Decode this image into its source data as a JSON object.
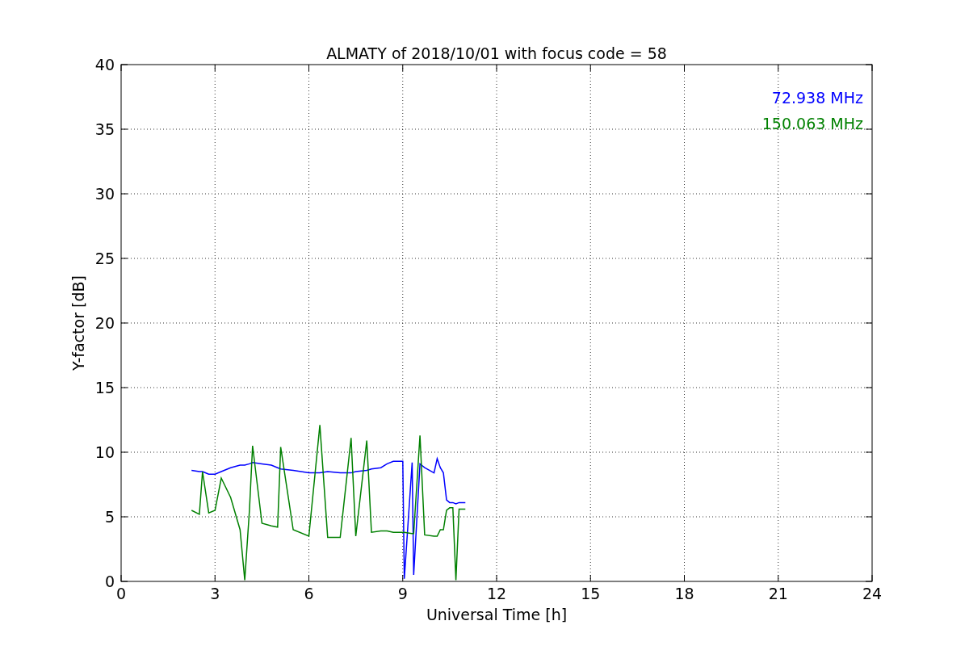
{
  "figure": {
    "chart_data": {
      "type": "line",
      "title": "ALMATY of 2018/10/01 with focus code = 58",
      "xlabel": "Universal Time [h]",
      "ylabel": "Y-factor [dB]",
      "xlim": [
        0,
        24
      ],
      "ylim": [
        0,
        40
      ],
      "xticks": [
        0,
        3,
        6,
        9,
        12,
        15,
        18,
        21,
        24
      ],
      "yticks": [
        0,
        5,
        10,
        15,
        20,
        25,
        30,
        35,
        40
      ],
      "grid": true,
      "x": [
        2.25,
        2.5,
        2.6,
        2.8,
        3,
        3.2,
        3.5,
        3.8,
        3.95,
        4.1,
        4.2,
        4.5,
        4.8,
        5,
        5.1,
        5.5,
        6,
        6.35,
        6.6,
        7,
        7.35,
        7.5,
        7.85,
        8,
        8.3,
        8.5,
        8.7,
        9,
        9.05,
        9.3,
        9.35,
        9.55,
        9.7,
        10,
        10.1,
        10.2,
        10.3,
        10.4,
        10.5,
        10.6,
        10.7,
        10.8,
        11
      ],
      "series": [
        {
          "name": "72.938 MHz",
          "color": "#0000ff",
          "values": [
            8.6,
            8.5,
            8.5,
            8.3,
            8.3,
            8.5,
            8.8,
            9.0,
            9.0,
            9.1,
            9.2,
            9.1,
            9.0,
            8.8,
            8.7,
            8.6,
            8.4,
            8.4,
            8.5,
            8.4,
            8.4,
            8.5,
            8.6,
            8.7,
            8.8,
            9.1,
            9.3,
            9.3,
            0.2,
            9.2,
            0.5,
            9.1,
            8.8,
            8.4,
            9.5,
            8.8,
            8.4,
            6.3,
            6.1,
            6.1,
            6.0,
            6.1,
            6.1
          ]
        },
        {
          "name": "150.063 MHz",
          "color": "#008000",
          "values": [
            5.5,
            5.2,
            8.5,
            5.3,
            5.5,
            8.0,
            6.5,
            4.0,
            0.1,
            5.5,
            10.5,
            4.5,
            4.3,
            4.2,
            10.4,
            4.0,
            3.5,
            12.1,
            3.4,
            3.4,
            11.1,
            3.5,
            10.9,
            3.8,
            3.9,
            3.9,
            3.8,
            3.8,
            3.8,
            3.7,
            3.7,
            11.3,
            3.6,
            3.5,
            3.5,
            4.0,
            4.0,
            5.5,
            5.7,
            5.7,
            0.1,
            5.6,
            5.6
          ]
        }
      ]
    }
  }
}
